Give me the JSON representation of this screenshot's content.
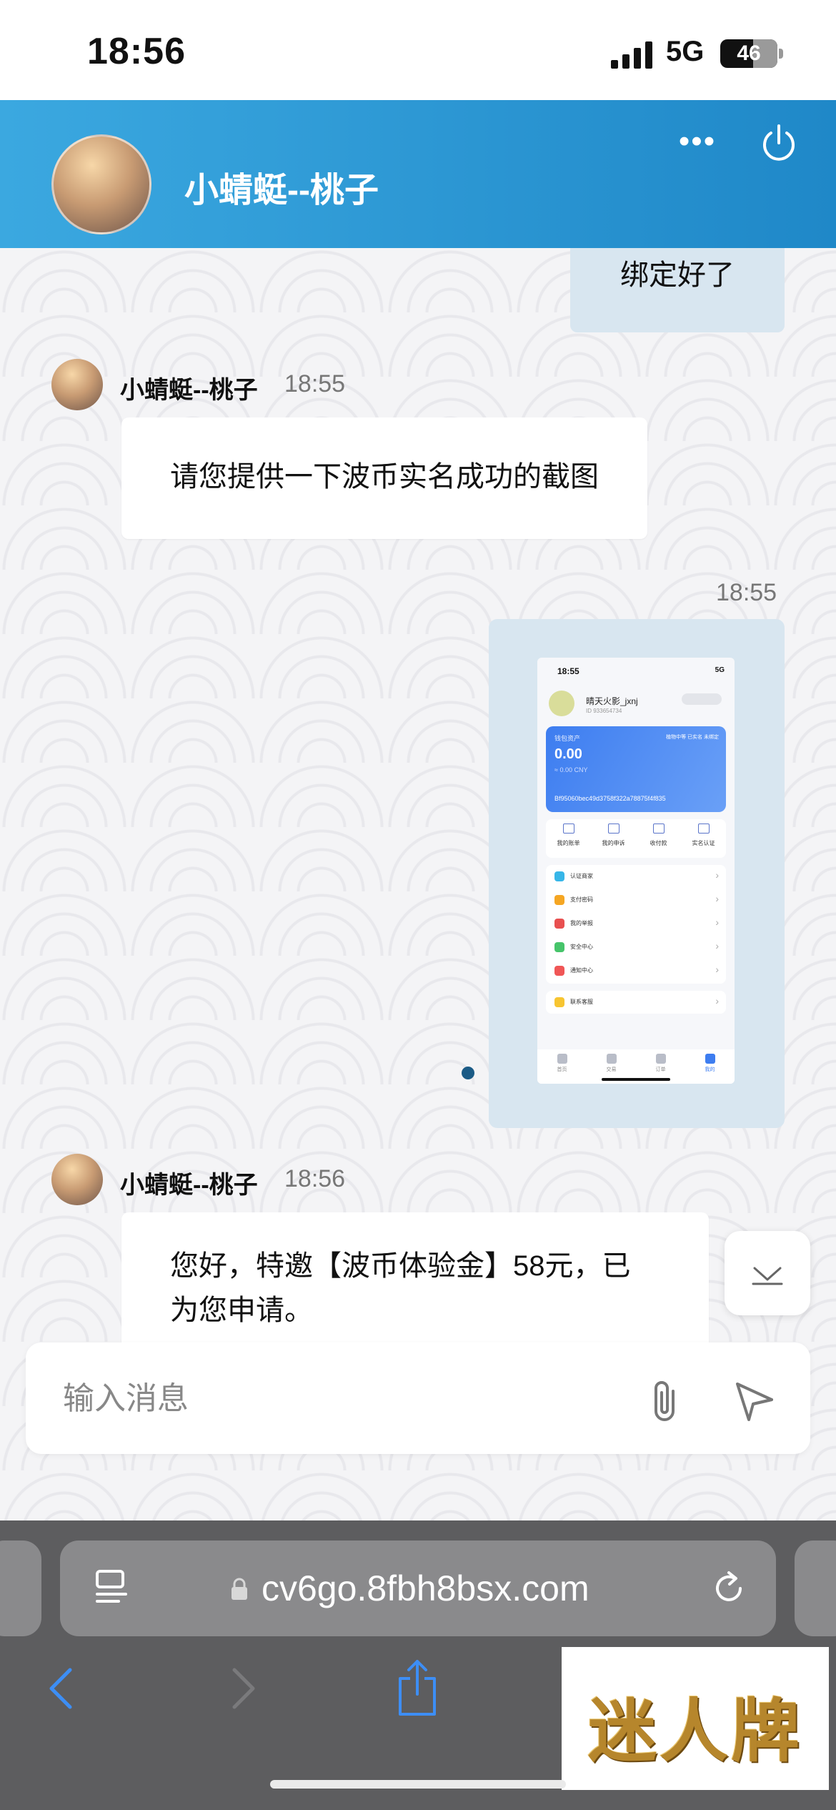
{
  "status_bar": {
    "time": "18:56",
    "network": "5G",
    "battery": "46"
  },
  "header": {
    "contact_name": "小蜻蜓--桃子"
  },
  "messages": {
    "m1": {
      "text": "绑定好了"
    },
    "m2": {
      "sender": "小蜻蜓--桃子",
      "time": "18:55",
      "text": "请您提供一下波币实名成功的截图"
    },
    "m3": {
      "time": "18:55"
    },
    "m4": {
      "sender": "小蜻蜓--桃子",
      "time": "18:56",
      "text_line1": "您好，特邀【波币体验金】58元，已",
      "text_line2": "为您申请。"
    }
  },
  "screenshot": {
    "time": "18:55",
    "status": "5G",
    "user_name": "晴天火影_jxnj",
    "user_id": "ID 933654734",
    "wallet_label": "钱包资产",
    "tags": "植物中等  已实名  未绑定",
    "balance": "0.00",
    "cny": "≈ 0.00 CNY",
    "address": "Bf95060bec49d3758f322a78875f4f835",
    "actions": [
      "我的账单",
      "我的申诉",
      "收付款",
      "实名认证"
    ],
    "menu": [
      "认证商家",
      "支付密码",
      "我的举报",
      "安全中心",
      "通知中心"
    ],
    "service": "联系客服",
    "tabs": [
      "首页",
      "交易",
      "订单",
      "我的"
    ]
  },
  "input": {
    "placeholder": "输入消息"
  },
  "safari": {
    "url": "cv6go.8fbh8bsx.com"
  },
  "watermark": {
    "text": "迷人牌"
  },
  "colors": {
    "header_start": "#3ba8e0",
    "header_end": "#1f88c8",
    "outgoing_bubble": "#d8e6f0"
  }
}
